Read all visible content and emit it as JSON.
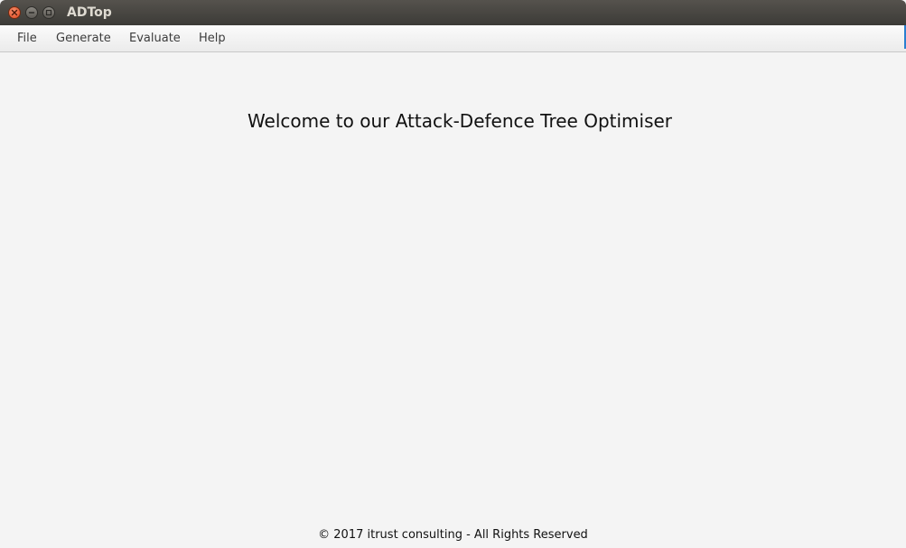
{
  "window": {
    "title": "ADTop"
  },
  "titlebar_buttons": {
    "close_icon": "close-icon",
    "minimize_icon": "minimize-icon",
    "maximize_icon": "maximize-icon"
  },
  "menu": {
    "items": [
      {
        "label": "File"
      },
      {
        "label": "Generate"
      },
      {
        "label": "Evaluate"
      },
      {
        "label": "Help"
      }
    ]
  },
  "main": {
    "welcome_text": "Welcome to our Attack-Defence Tree Optimiser"
  },
  "footer": {
    "copyright": "© 2017 itrust consulting - All Rights Reserved"
  },
  "colors": {
    "titlebar": "#3c3b37",
    "close_button": "#e0491f",
    "content_background": "#f4f4f4"
  }
}
